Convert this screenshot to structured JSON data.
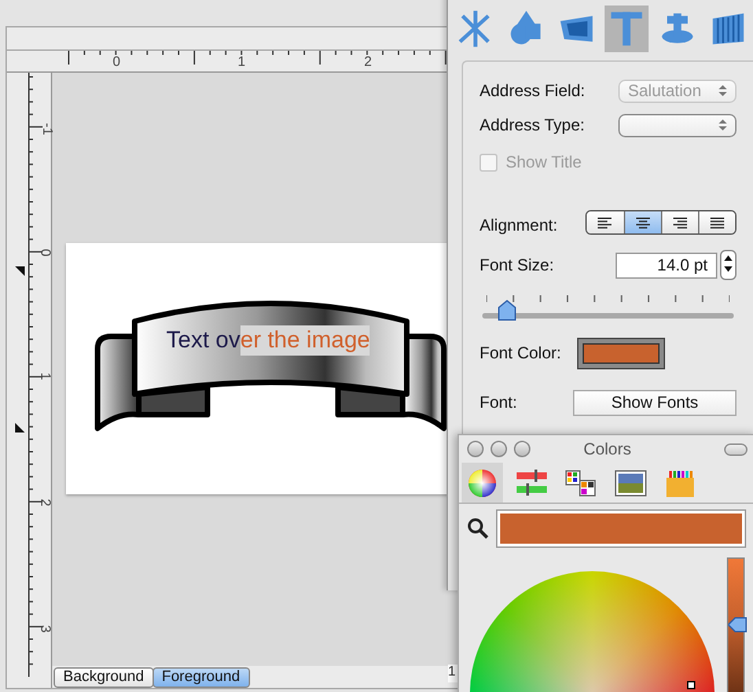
{
  "document": {
    "h_ruler_labels": [
      "0",
      "1",
      "2"
    ],
    "v_ruler_labels": [
      "-1",
      "0",
      "1",
      "2",
      "3"
    ],
    "banner_text": [
      {
        "text": "Text ov",
        "selected": false
      },
      {
        "text": "er the image",
        "selected": true
      }
    ],
    "tabs": [
      {
        "label": "Background",
        "selected": false
      },
      {
        "label": "Foreground",
        "selected": true
      }
    ],
    "behind_field": "1"
  },
  "inspector": {
    "toolbar": [
      {
        "kind": "axes",
        "selected": false
      },
      {
        "kind": "shapes",
        "selected": false
      },
      {
        "kind": "frame",
        "selected": false
      },
      {
        "kind": "text",
        "selected": true
      },
      {
        "kind": "database",
        "selected": false
      },
      {
        "kind": "barcode",
        "selected": false
      }
    ],
    "address_field": {
      "label": "Address Field:",
      "value": "Salutation",
      "disabled": true
    },
    "address_type": {
      "label": "Address Type:",
      "disabled": false
    },
    "show_title": {
      "label": "Show Title",
      "checked": false,
      "disabled": true
    },
    "alignment": {
      "label": "Alignment:",
      "options": [
        {
          "kind": "left",
          "selected": false
        },
        {
          "kind": "center",
          "selected": true
        },
        {
          "kind": "right",
          "selected": false
        },
        {
          "kind": "justify",
          "selected": false
        }
      ]
    },
    "font_size": {
      "label": "Font Size:",
      "value": "14.0 pt",
      "level": 0.1
    },
    "font_color": {
      "label": "Font Color:",
      "color": "#c8622e"
    },
    "font": {
      "label": "Font:",
      "button": "Show Fonts"
    }
  },
  "colors": {
    "title": "Colors",
    "modes": [
      {
        "kind": "wheel",
        "selected": true
      },
      {
        "kind": "sliders",
        "selected": false
      },
      {
        "kind": "palettes",
        "selected": false
      },
      {
        "kind": "image",
        "selected": false
      },
      {
        "kind": "crayons",
        "selected": false
      }
    ],
    "color": "#c8622e",
    "brightness": {
      "level": 0.56
    }
  }
}
